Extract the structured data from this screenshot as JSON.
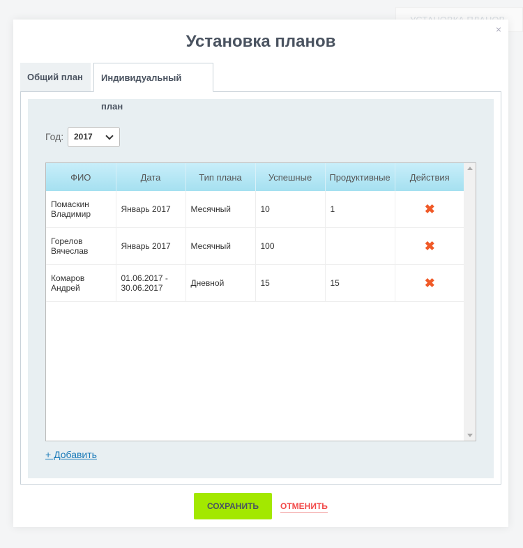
{
  "background": {
    "button_label": "Установка планов"
  },
  "modal": {
    "title": "Установка планов",
    "close": "×",
    "tabs": [
      {
        "label": "Общий план"
      },
      {
        "label": "Индивидуальный план"
      }
    ],
    "year_label": "Год:",
    "year_value": "2017",
    "table": {
      "headers": [
        "ФИО",
        "Дата",
        "Тип плана",
        "Успешные",
        "Продуктивные",
        "Действия"
      ],
      "rows": [
        {
          "name": "Помаскин Владимир",
          "date": "Январь 2017",
          "type": "Месячный",
          "success": "10",
          "productive": "1",
          "action": "✖"
        },
        {
          "name": "Горелов Вячеслав",
          "date": "Январь 2017",
          "type": "Месячный",
          "success": "100",
          "productive": "",
          "action": "✖"
        },
        {
          "name": "Комаров Андрей",
          "date": "01.06.2017 - 30.06.2017",
          "type": "Дневной",
          "success": "15",
          "productive": "15",
          "action": "✖"
        }
      ]
    },
    "add_label": "+ Добавить",
    "save_label": "СОХРАНИТЬ",
    "cancel_label": "ОТМЕНИТЬ"
  }
}
